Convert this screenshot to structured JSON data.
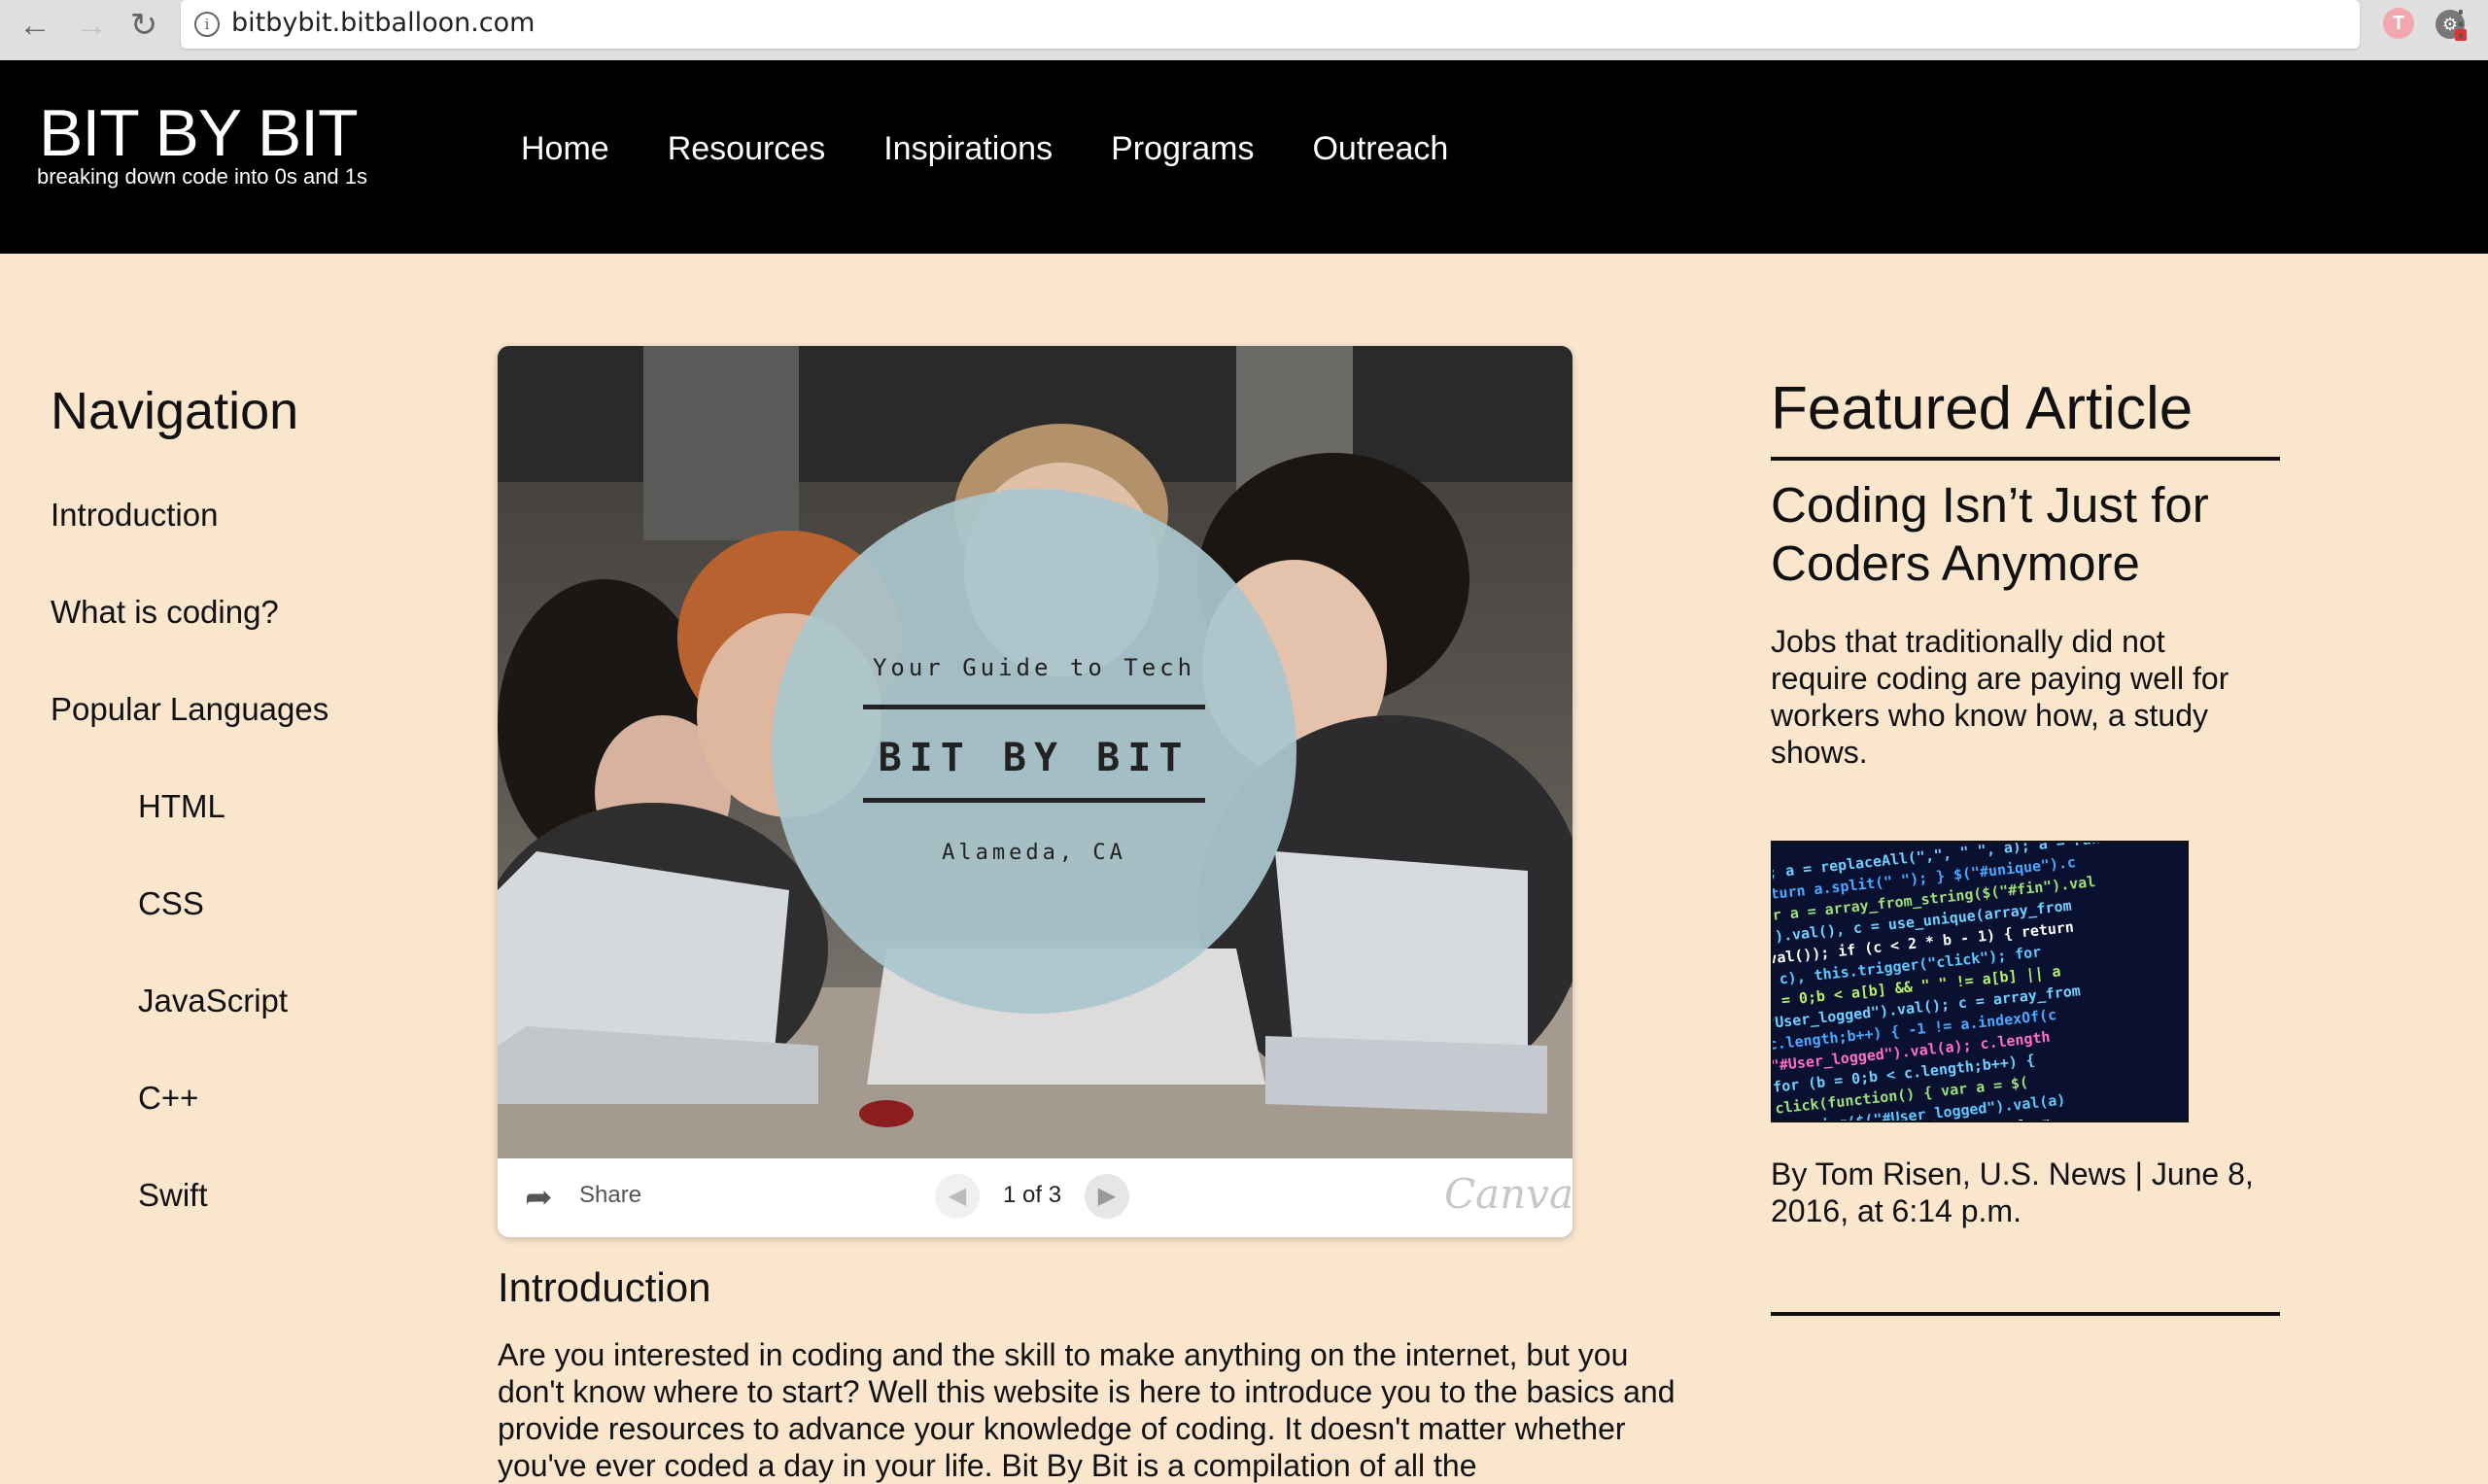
{
  "browser": {
    "url": "bitbybit.bitballoon.com",
    "profile_initial": "T"
  },
  "site": {
    "logo_title": "BIT BY BIT",
    "logo_tagline": "breaking down code into 0s and 1s",
    "nav": [
      "Home",
      "Resources",
      "Inspirations",
      "Programs",
      "Outreach"
    ]
  },
  "sidebar": {
    "heading": "Navigation",
    "items": [
      "Introduction",
      "What is coding?",
      "Popular Languages"
    ],
    "languages": [
      "HTML",
      "CSS",
      "JavaScript",
      "C++",
      "Swift"
    ]
  },
  "slideshow": {
    "subtitle": "Your Guide to Tech",
    "title": "BIT BY BIT",
    "location": "Alameda, CA",
    "share_label": "Share",
    "counter": "1 of 3",
    "brand": "Canva"
  },
  "intro": {
    "heading": "Introduction",
    "body": "Are you interested in coding and the skill to make anything on the internet, but you don't know where to start? Well this website is here to introduce you to the basics and provide resources to advance your knowledge of coding. It doesn't matter whether you've ever coded a day in your life. Bit By Bit is a compilation of all the"
  },
  "featured": {
    "heading": "Featured Article",
    "title": "Coding Isn’t Just for Coders Anymore",
    "summary": "Jobs that traditionally did not require coding are paying well for workers who know how, a study shows.",
    "byline": "By Tom Risen, U.S. News | June 8, 2016, at 6:14 p.m."
  },
  "colors": {
    "page_bg": "#fae5cd",
    "header_bg": "#000000",
    "circle": "#aac6cd"
  }
}
